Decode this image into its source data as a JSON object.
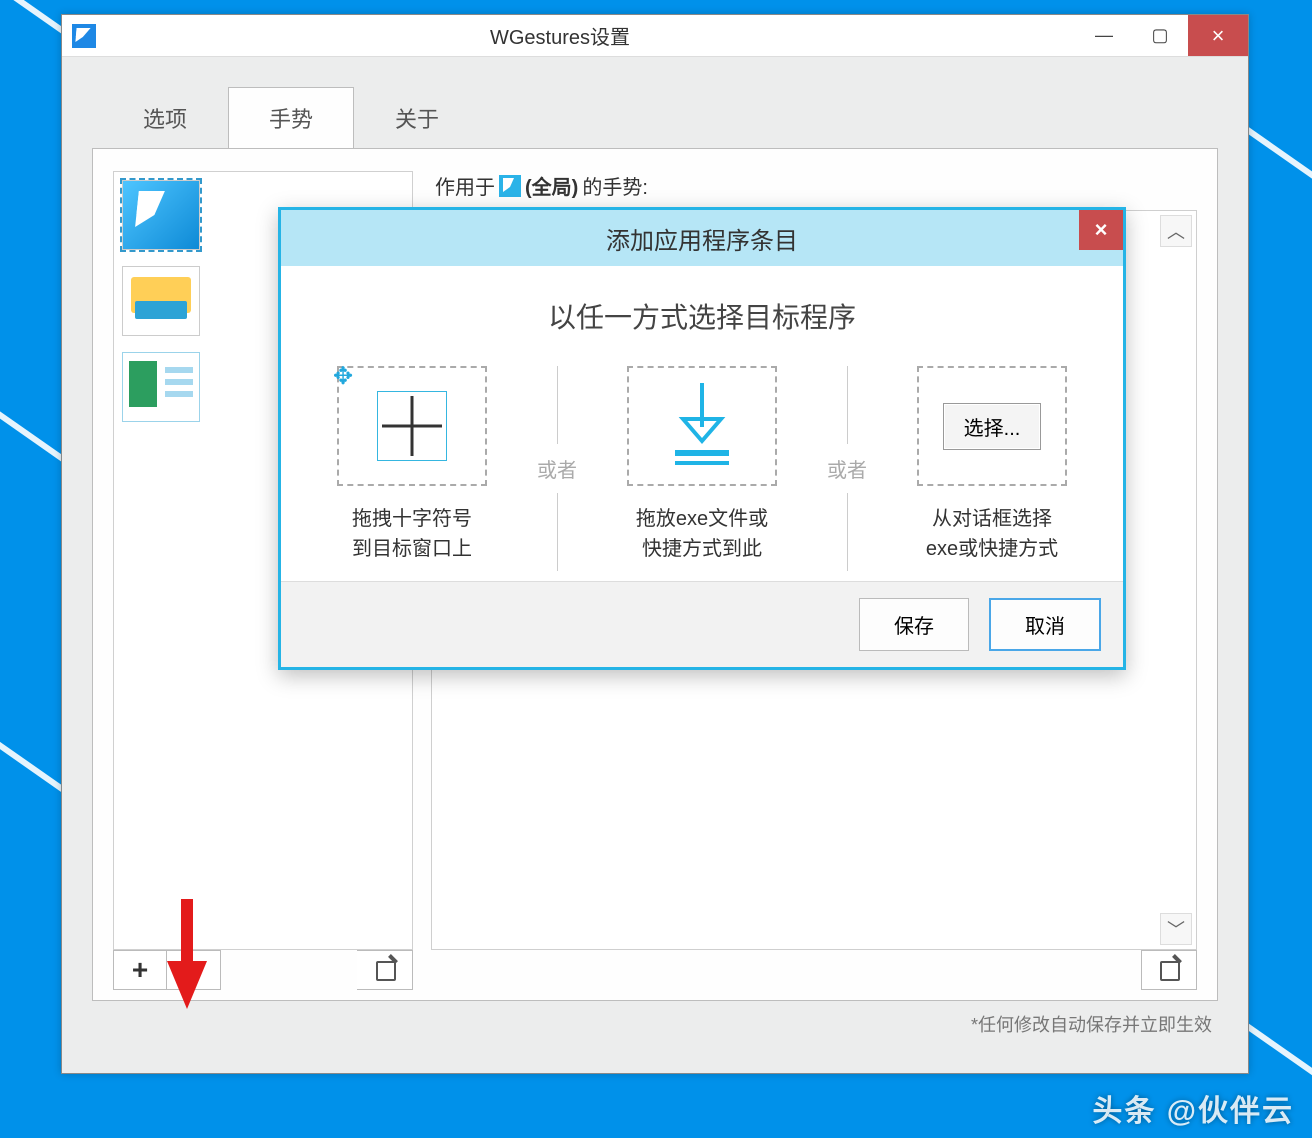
{
  "window": {
    "title": "WGestures设置"
  },
  "tabs": {
    "options": "选项",
    "gestures": "手势",
    "about": "关于"
  },
  "context": {
    "prefix": "作用于",
    "global": "(全局)",
    "suffix": "的手势:"
  },
  "sidebar_buttons": {
    "add": "+",
    "remove": "−"
  },
  "footnote": "*任何修改自动保存并立即生效",
  "modal": {
    "title": "添加应用程序条目",
    "subtitle": "以任一方式选择目标程序",
    "or": "或者",
    "choice1_l1": "拖拽十字符号",
    "choice1_l2": "到目标窗口上",
    "choice2_l1": "拖放exe文件或",
    "choice2_l2": "快捷方式到此",
    "choice3_l1": "从对话框选择",
    "choice3_l2": "exe或快捷方式",
    "browse": "选择...",
    "save": "保存",
    "cancel": "取消"
  },
  "watermark": "头条 @伙伴云"
}
